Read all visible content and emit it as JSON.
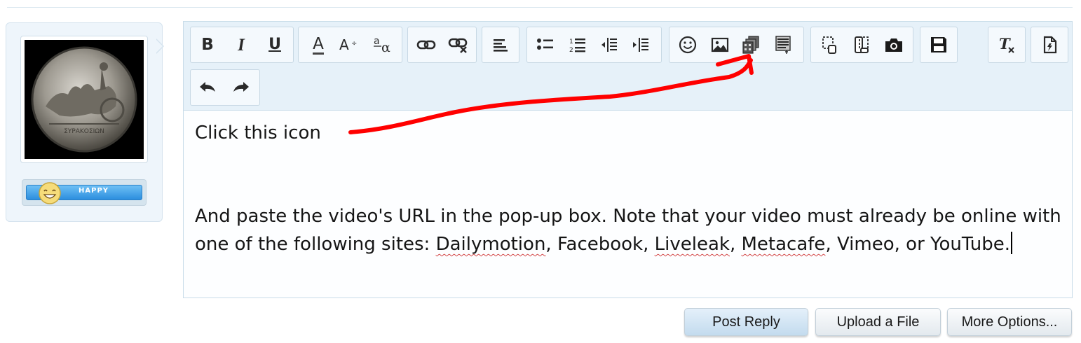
{
  "user_card": {
    "avatar_icon": "coin-avatar",
    "mood_label": "HAPPY",
    "mood_icon": "smiley-face-icon"
  },
  "toolbar": {
    "row1": [
      {
        "name": "bold-button",
        "icon": "bold",
        "label": "B"
      },
      {
        "name": "italic-button",
        "icon": "italic",
        "label": "I"
      },
      {
        "name": "underline-button",
        "icon": "underline",
        "label": "U"
      },
      {
        "name": "text-color-button",
        "icon": "font-color",
        "label": "A"
      },
      {
        "name": "font-size-button",
        "icon": "font-size",
        "label": "A"
      },
      {
        "name": "font-family-button",
        "icon": "font-family",
        "label": "a"
      },
      {
        "name": "link-button",
        "icon": "link-icon"
      },
      {
        "name": "unlink-button",
        "icon": "unlink-icon"
      },
      {
        "name": "align-button",
        "icon": "align-left-icon"
      },
      {
        "name": "bullet-list-button",
        "icon": "bullet-list-icon"
      },
      {
        "name": "numbered-list-button",
        "icon": "numbered-list-icon"
      },
      {
        "name": "outdent-button",
        "icon": "outdent-icon"
      },
      {
        "name": "indent-button",
        "icon": "indent-icon"
      },
      {
        "name": "smilie-button",
        "icon": "smiley-icon"
      },
      {
        "name": "image-button",
        "icon": "image-icon"
      },
      {
        "name": "media-button",
        "icon": "media-film-icon"
      },
      {
        "name": "insert-button",
        "icon": "insert-block-icon"
      },
      {
        "name": "quote-button",
        "icon": "quote-icon"
      },
      {
        "name": "spoiler-button",
        "icon": "spoiler-icon"
      },
      {
        "name": "screenshot-button",
        "icon": "camera-icon"
      },
      {
        "name": "save-draft-button",
        "icon": "floppy-disk-icon"
      },
      {
        "name": "remove-format-button",
        "icon": "remove-format-icon"
      },
      {
        "name": "toggle-bbcode-button",
        "icon": "toggle-source-icon"
      }
    ],
    "row2": [
      {
        "name": "undo-button",
        "icon": "undo-arrow-icon"
      },
      {
        "name": "redo-button",
        "icon": "redo-arrow-icon"
      }
    ]
  },
  "editor": {
    "line1": "Click this icon",
    "para2_part1": "And paste the video's URL in the pop-up box.  Note that your video must already be online with one of the following sites:  ",
    "site_dailymotion": "Dailymotion",
    "sep1": ", Facebook, ",
    "site_liveleak": "Liveleak",
    "sep2": ", ",
    "site_metacafe": "Metacafe",
    "para2_part2": ", Vimeo, or YouTube.",
    "annotation_color": "#ff0000"
  },
  "actions": {
    "post_reply": "Post Reply",
    "upload_file": "Upload a File",
    "more_options": "More Options..."
  }
}
